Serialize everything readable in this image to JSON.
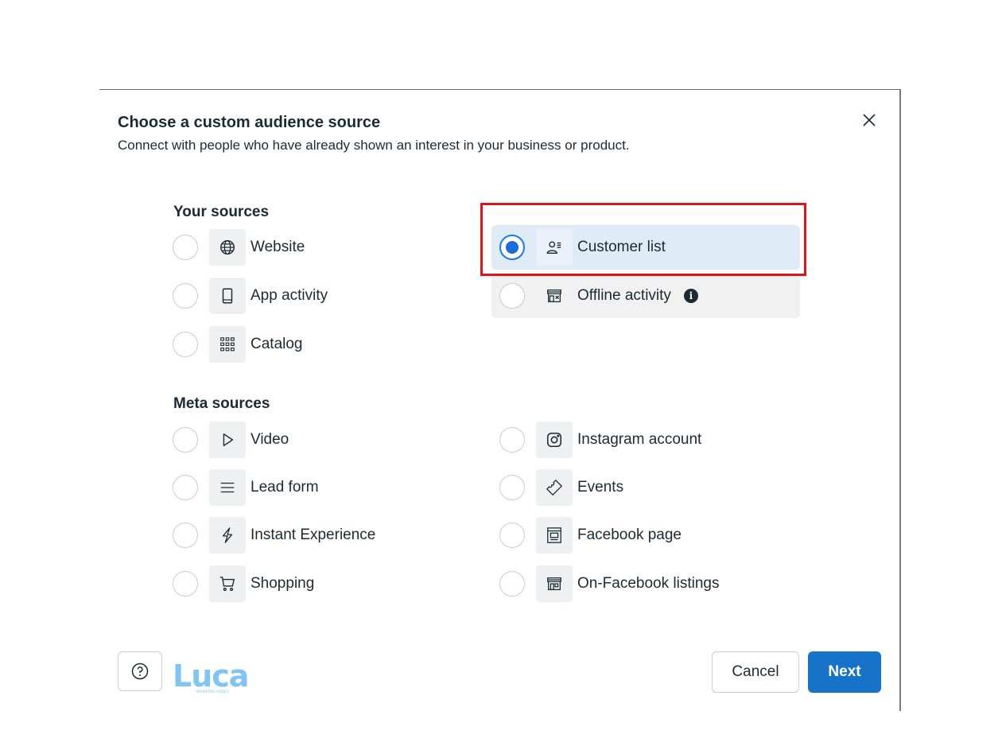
{
  "dialog": {
    "title": "Choose a custom audience source",
    "subtitle": "Connect with people who have already shown an interest in your business or product."
  },
  "your_sources": {
    "heading": "Your sources",
    "options": [
      {
        "label": "Website",
        "icon": "globe-icon",
        "selected": false
      },
      {
        "label": "App activity",
        "icon": "mobile-device-icon",
        "selected": false
      },
      {
        "label": "Catalog",
        "icon": "catalog-grid-icon",
        "selected": false
      },
      {
        "label": "Customer list",
        "icon": "customer-list-icon",
        "selected": true
      },
      {
        "label": "Offline activity",
        "icon": "store-icon",
        "selected": false,
        "info_icon": "info-icon"
      }
    ]
  },
  "meta_sources": {
    "heading": "Meta sources",
    "options": [
      {
        "label": "Video",
        "icon": "play-icon"
      },
      {
        "label": "Lead form",
        "icon": "lines-icon"
      },
      {
        "label": "Instant Experience",
        "icon": "lightning-icon"
      },
      {
        "label": "Shopping",
        "icon": "cart-icon"
      },
      {
        "label": "Instagram account",
        "icon": "instagram-icon"
      },
      {
        "label": "Events",
        "icon": "ticket-icon"
      },
      {
        "label": "Facebook page",
        "icon": "page-icon"
      },
      {
        "label": "On-Facebook listings",
        "icon": "shop-icon"
      }
    ]
  },
  "footer": {
    "cancel_label": "Cancel",
    "next_label": "Next",
    "logo_text": "Luca",
    "logo_tagline": "MARKETING AGENCY"
  },
  "colors": {
    "primary": "#1773c7",
    "selected_bg": "#dfebf7",
    "highlight": "#e0151b",
    "logo": "#7fc4f2"
  }
}
